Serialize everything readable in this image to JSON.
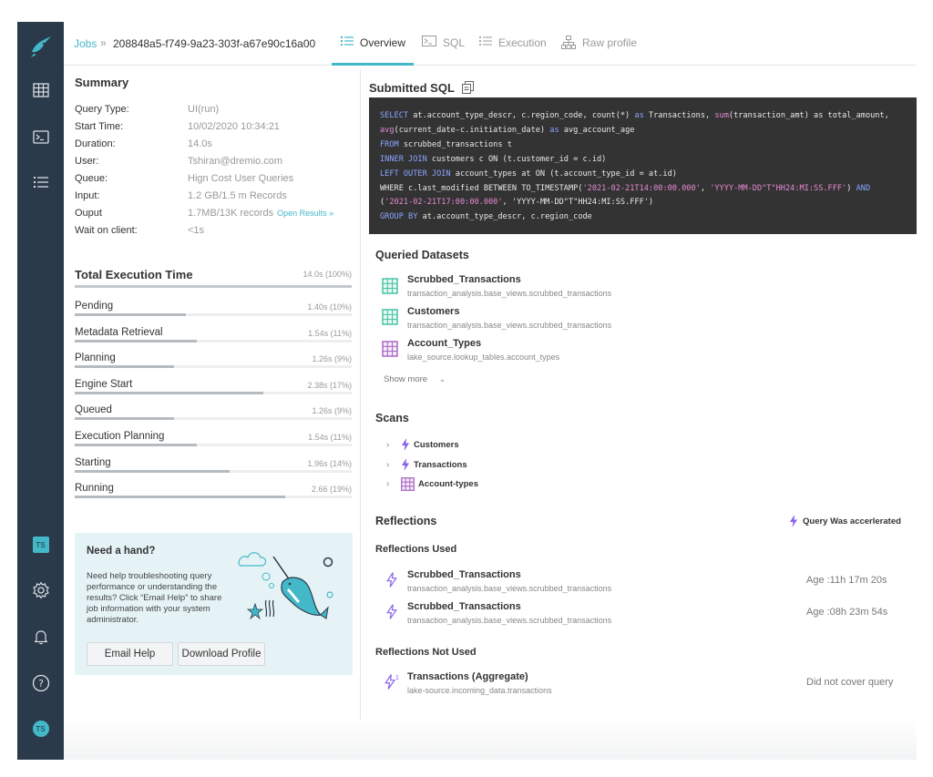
{
  "sidebar": {
    "logo": "narwhal-logo-icon",
    "items": [
      {
        "name": "datasets-icon"
      },
      {
        "name": "sql-runner-icon"
      },
      {
        "name": "jobs-icon"
      }
    ],
    "bottom": {
      "org_badge": "TS",
      "user_avatar": "TS"
    }
  },
  "breadcrumb": {
    "jobs": "Jobs",
    "sep": "»",
    "job_id": "208848a5-f749-9a23-303f-a67e90c16a00"
  },
  "tabs": [
    {
      "label": "Overview",
      "icon": "list-icon",
      "active": true
    },
    {
      "label": "SQL",
      "icon": "terminal-icon",
      "active": false
    },
    {
      "label": "Execution",
      "icon": "list-icon",
      "active": false
    },
    {
      "label": "Raw profile",
      "icon": "hierarchy-icon",
      "active": false
    }
  ],
  "summary": {
    "title": "Summary",
    "rows": [
      {
        "label": "Query Type:",
        "value": "UI(run)"
      },
      {
        "label": "Start Time:",
        "value": "10/02/2020 10:34:21"
      },
      {
        "label": "Duration:",
        "value": "14.0s"
      },
      {
        "label": "User:",
        "value": "Tshiran@dremio.com"
      },
      {
        "label": "Queue:",
        "value": "Hign Cost User Queries"
      },
      {
        "label": "Input:",
        "value": "1.2 GB/1.5 m Records"
      },
      {
        "label": "Ouput",
        "value": "1.7MB/13K records"
      },
      {
        "label": "Wait on client:",
        "value": "<1s"
      }
    ],
    "open_results": "Open Results »"
  },
  "execution": {
    "title": "Total Execution Time",
    "total": "14.0s (100%)",
    "total_fraction": 1.0,
    "phases": [
      {
        "label": "Pending",
        "value": "1.40s (10%)",
        "fraction": 0.1
      },
      {
        "label": "Metadata Retrieval",
        "value": "1.54s (11%)",
        "fraction": 0.11
      },
      {
        "label": "Planning",
        "value": "1.26s (9%)",
        "fraction": 0.09
      },
      {
        "label": "Engine Start",
        "value": "2.38s (17%)",
        "fraction": 0.17
      },
      {
        "label": "Queued",
        "value": "1.26s (9%)",
        "fraction": 0.09
      },
      {
        "label": "Execution Planning",
        "value": "1.54s (11%)",
        "fraction": 0.11
      },
      {
        "label": "Starting",
        "value": "1.96s (14%)",
        "fraction": 0.14
      },
      {
        "label": "Running",
        "value": "2.66 (19%)",
        "fraction": 0.19
      }
    ]
  },
  "help": {
    "title": "Need a hand?",
    "text": "Need help troubleshooting query performance or understanding the results? Click “Email Help” to share job information with your system administrator.",
    "email_button": "Email Help",
    "download_button": "Download Profile"
  },
  "sql": {
    "title": "Submitted SQL",
    "copy_icon": "copy-icon"
  },
  "queried_datasets": {
    "title": "Queried Datasets",
    "items": [
      {
        "name": "Scrubbed_Transactions",
        "path": "transaction_analysis.base_views.scrubbed_transactions",
        "icon": "virtual-dataset-icon",
        "color": "#3cc0a0"
      },
      {
        "name": "Customers",
        "path": "transaction_analysis.base_views.scrubbed_transactions",
        "icon": "virtual-dataset-icon",
        "color": "#3cc0a0"
      },
      {
        "name": "Account_Types",
        "path": "lake_source.lookup_tables.account_types",
        "icon": "physical-dataset-icon",
        "color": "#a55fc0"
      }
    ],
    "show_more": "Show more"
  },
  "scans": {
    "title": "Scans",
    "items": [
      {
        "name": "Customers",
        "icon": "lightning-icon"
      },
      {
        "name": "Transactions",
        "icon": "lightning-icon"
      },
      {
        "name": "Account-types",
        "icon": "physical-dataset-icon"
      }
    ]
  },
  "reflections": {
    "title": "Reflections",
    "accelerated_label": "Query Was accerlerated",
    "used_title": "Reflections Used",
    "used": [
      {
        "name": "Scrubbed_Transactions",
        "path": "transaction_analysis.base_views.scrubbed_transactions",
        "age": "Age :11h 17m 20s"
      },
      {
        "name": "Scrubbed_Transactions",
        "path": "transaction_analysis.base_views.scrubbed_transactions",
        "age": "Age :08h 23m 54s"
      }
    ],
    "not_used_title": "Reflections Not Used",
    "not_used": [
      {
        "name": "Transactions (Aggregate)",
        "path": "lake-source.incoming_data.transactions",
        "reason": "Did not cover query"
      }
    ]
  },
  "colors": {
    "sidebar": "#2a3a4a",
    "accent": "#43b8c9",
    "lightning": "#8a63ea",
    "dataset_green": "#3cc0a0",
    "dataset_purple": "#a55fc0"
  }
}
